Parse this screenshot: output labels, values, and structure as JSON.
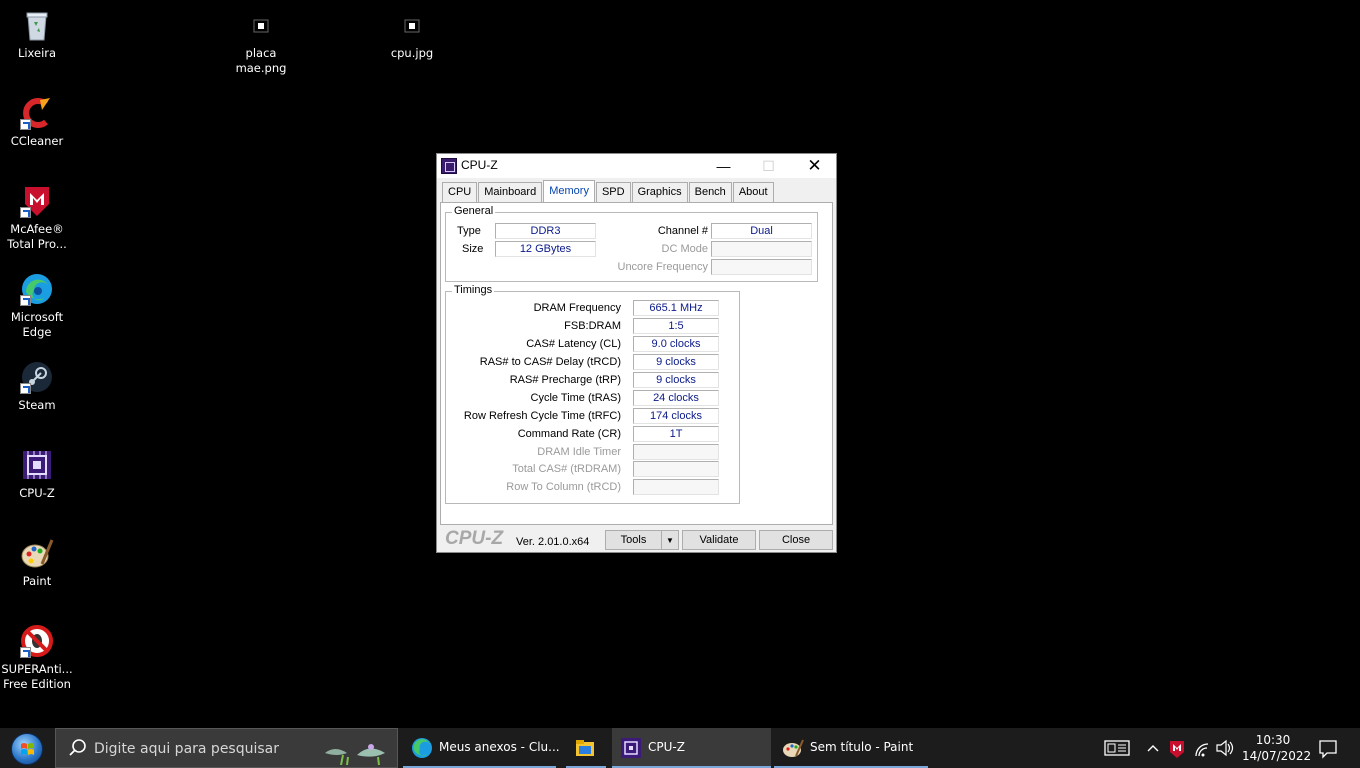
{
  "desktop": {
    "icons": [
      {
        "label": "Lixeira"
      },
      {
        "label": "CCleaner"
      },
      {
        "label": "McAfee® Total Pro..."
      },
      {
        "label": "Microsoft Edge"
      },
      {
        "label": "Steam"
      },
      {
        "label": "CPU-Z"
      },
      {
        "label": "Paint"
      },
      {
        "label": "SUPERAnti... Free Edition"
      },
      {
        "label": "placa mae.png"
      },
      {
        "label": "cpu.jpg"
      }
    ]
  },
  "window": {
    "title": "CPU-Z",
    "tabs": [
      "CPU",
      "Mainboard",
      "Memory",
      "SPD",
      "Graphics",
      "Bench",
      "About"
    ],
    "active_tab": "Memory",
    "general": {
      "title": "General",
      "type_label": "Type",
      "type_value": "DDR3",
      "size_label": "Size",
      "size_value": "12 GBytes",
      "channel_label": "Channel #",
      "channel_value": "Dual",
      "dcmode_label": "DC Mode",
      "dcmode_value": "",
      "uncore_label": "Uncore Frequency",
      "uncore_value": ""
    },
    "timings": {
      "title": "Timings",
      "rows": [
        {
          "label": "DRAM Frequency",
          "value": "665.1 MHz",
          "enabled": true
        },
        {
          "label": "FSB:DRAM",
          "value": "1:5",
          "enabled": true
        },
        {
          "label": "CAS# Latency (CL)",
          "value": "9.0 clocks",
          "enabled": true
        },
        {
          "label": "RAS# to CAS# Delay (tRCD)",
          "value": "9 clocks",
          "enabled": true
        },
        {
          "label": "RAS# Precharge (tRP)",
          "value": "9 clocks",
          "enabled": true
        },
        {
          "label": "Cycle Time (tRAS)",
          "value": "24 clocks",
          "enabled": true
        },
        {
          "label": "Row Refresh Cycle Time (tRFC)",
          "value": "174 clocks",
          "enabled": true
        },
        {
          "label": "Command Rate (CR)",
          "value": "1T",
          "enabled": true
        },
        {
          "label": "DRAM Idle Timer",
          "value": "",
          "enabled": false
        },
        {
          "label": "Total CAS# (tRDRAM)",
          "value": "",
          "enabled": false
        },
        {
          "label": "Row To Column (tRCD)",
          "value": "",
          "enabled": false
        }
      ]
    },
    "footer": {
      "logo": "CPU-Z",
      "version": "Ver. 2.01.0.x64",
      "tools_label": "Tools",
      "validate_label": "Validate",
      "close_label": "Close"
    }
  },
  "taskbar": {
    "search_placeholder": "Digite aqui para pesquisar",
    "apps": [
      {
        "label": "Meus anexos - Clu..."
      },
      {
        "label": ""
      },
      {
        "label": "CPU-Z"
      },
      {
        "label": "Sem título - Paint"
      }
    ],
    "time": "10:30",
    "date": "14/07/2022"
  },
  "colors": {
    "value_text": "#0b1a8a",
    "active_tab_text": "#0645ad",
    "taskbar_bg": "#1c1c1c"
  }
}
